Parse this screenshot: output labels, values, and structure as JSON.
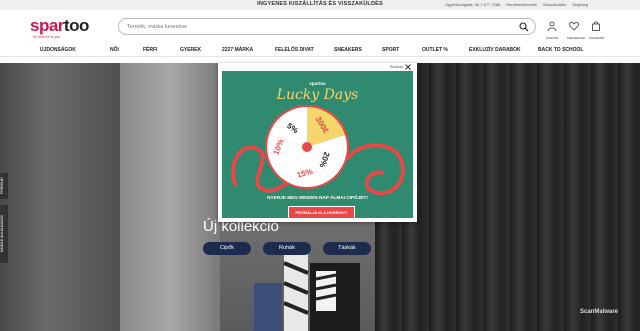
{
  "topbar": {
    "promo": "INGYENES KISZÁLLÍTÁS ÉS VISSZAKÜLDÉS",
    "links": [
      "Ügyfélszolgálat: 06 1 677 7688",
      "Rendeléskövetés",
      "Visszaküldés",
      "Segítség"
    ]
  },
  "header": {
    "logo_part1": "spar",
    "logo_part2": "too",
    "tagline": "it's love for to you",
    "search_placeholder": "Termék, márka keresése",
    "icons": [
      {
        "name": "user-icon",
        "label": "FIÓKOM"
      },
      {
        "name": "heart-icon",
        "label": "KEDVENCEK"
      },
      {
        "name": "bag-icon",
        "label": "KOSARAM"
      }
    ]
  },
  "nav": {
    "items": [
      "ÚJDONSÁGOK",
      "NŐI",
      "FÉRFI",
      "GYEREK",
      "2227 MÁRKA",
      "FELELŐS DIVAT",
      "SNEAKERS",
      "SPORT",
      "OUTLET %",
      "EXKLUZÍV DARABOK",
      "BACK TO SCHOOL"
    ]
  },
  "hero": {
    "title": "Új kollekció",
    "pills": [
      "Cipők",
      "Ruhák",
      "Táskák"
    ],
    "side_tabs": [
      "PRÉMIUM",
      "MOBILE ALKALMAZÁS"
    ]
  },
  "popup": {
    "close_label": "Bezárás",
    "brand": "spartoo",
    "title": "Lucky Days",
    "claim": "NYERJE MEG MINDEN NAP ÁLMAI CIPŐJÉT!",
    "cta": "PRÓBÁLJA KI A KERÉKET!",
    "wheel_segments": [
      "5%",
      "300€",
      "20%",
      "15%",
      "10%"
    ]
  },
  "watermark": "ScanMalware",
  "colors": {
    "brand": "#c41c4d",
    "popup_green": "#2f8a6f",
    "cta_red": "#e84848",
    "pill_navy": "#1d2b4f",
    "lucky_gold": "#f4d66b"
  }
}
